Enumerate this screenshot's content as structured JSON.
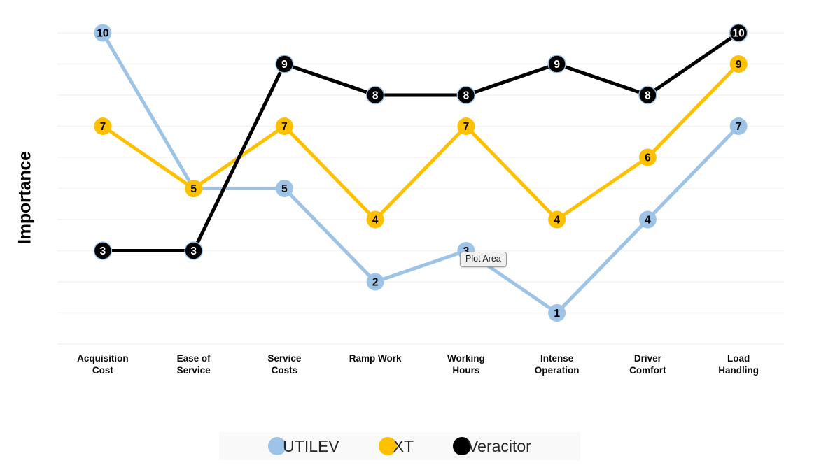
{
  "chart_data": {
    "type": "line",
    "title": "",
    "xlabel": "",
    "ylabel": "Importance",
    "ylim": [
      0,
      10
    ],
    "grid": true,
    "legend_position": "bottom",
    "categories": [
      "Acquisition\nCost",
      "Ease of\nService",
      "Service\nCosts",
      "Ramp Work",
      "Working\nHours",
      "Intense\nOperation",
      "Driver\nComfort",
      "Load\nHandling"
    ],
    "series": [
      {
        "name": "UTILEV",
        "color": "#9DC3E6",
        "values": [
          10,
          5,
          5,
          2,
          3,
          1,
          4,
          7
        ]
      },
      {
        "name": "XT",
        "color": "#FFC000",
        "values": [
          7,
          5,
          7,
          4,
          7,
          4,
          6,
          9
        ]
      },
      {
        "name": "Veracitor",
        "color": "#000000",
        "values": [
          3,
          3,
          9,
          8,
          8,
          9,
          8,
          10
        ]
      }
    ]
  },
  "axis": {
    "y_title": "Importance"
  },
  "legend": {
    "items": [
      {
        "label": "UTILEV",
        "color": "#9DC3E6"
      },
      {
        "label": "XT",
        "color": "#FFC000"
      },
      {
        "label": "Veracitor",
        "color": "#000000"
      }
    ]
  },
  "tooltip": {
    "text": "Plot Area"
  },
  "colors": {
    "utilev": "#9DC3E6",
    "xt": "#FFC000",
    "veracitor": "#000000",
    "gridline": "#F2F2F2",
    "legend_background": "#F9F9F9",
    "page_background": "#FFFFFF"
  }
}
